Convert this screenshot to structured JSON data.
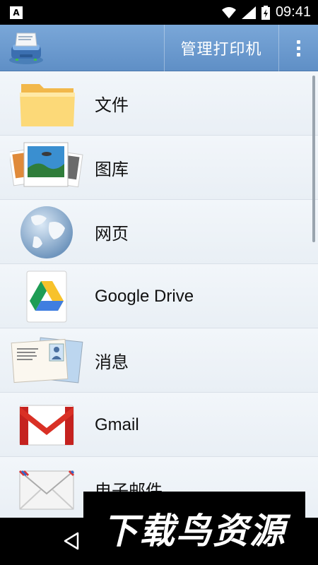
{
  "status_bar": {
    "time": "09:41",
    "left_icon": "A"
  },
  "app_bar": {
    "logo_icon": "printer-icon",
    "manage_label": "管理打印机",
    "overflow_icon": "more-vert-icon"
  },
  "list": {
    "items": [
      {
        "label": "文件",
        "icon": "folder-icon"
      },
      {
        "label": "图库",
        "icon": "photos-icon"
      },
      {
        "label": "网页",
        "icon": "globe-icon"
      },
      {
        "label": "Google Drive",
        "icon": "google-drive-icon"
      },
      {
        "label": "消息",
        "icon": "postcard-icon"
      },
      {
        "label": "Gmail",
        "icon": "gmail-icon"
      },
      {
        "label": "电子邮件",
        "icon": "envelope-icon"
      }
    ]
  },
  "watermark": {
    "text": "下载鸟资源"
  },
  "colors": {
    "appbar": "#6b9bd0",
    "list_bg": "#eef3f8"
  }
}
